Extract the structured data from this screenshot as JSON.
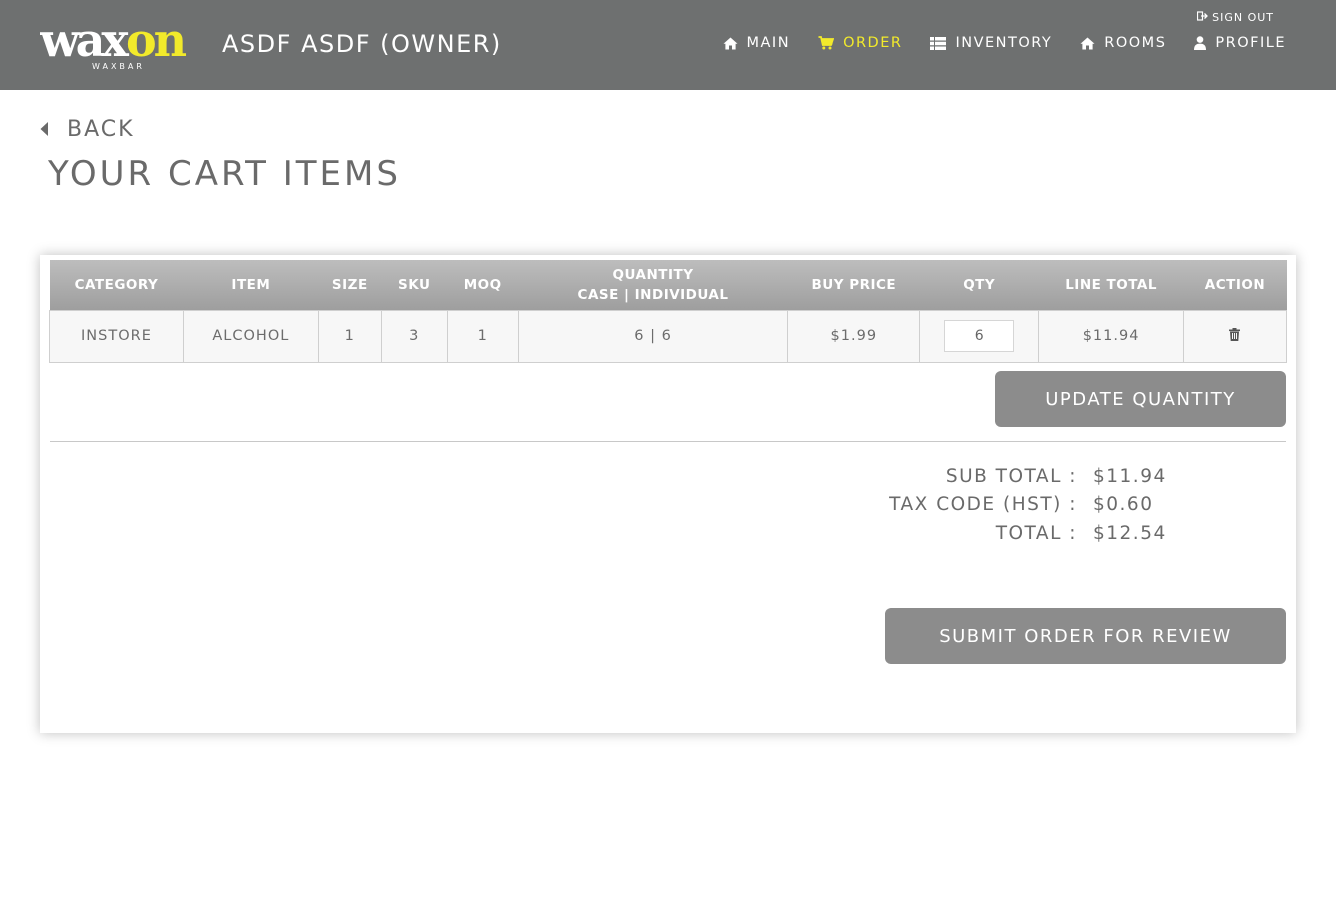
{
  "header": {
    "logo_text": "waxon",
    "logo_sub": "WAXBAR",
    "owner_label": "ASDF ASDF (OWNER)",
    "signout_label": "SIGN OUT",
    "nav": [
      {
        "label": "MAIN",
        "icon": "home-icon",
        "active": false
      },
      {
        "label": "ORDER",
        "icon": "cart-icon",
        "active": true
      },
      {
        "label": "INVENTORY",
        "icon": "list-icon",
        "active": false
      },
      {
        "label": "ROOMS",
        "icon": "home-icon",
        "active": false
      },
      {
        "label": "PROFILE",
        "icon": "user-icon",
        "active": false
      }
    ]
  },
  "colors": {
    "header_bg": "#6e7070",
    "accent": "#f2ea2b",
    "button_bg": "#8c8c8c"
  },
  "back_label": "BACK",
  "page_title": "YOUR CART ITEMS",
  "cart": {
    "columns": [
      "CATEGORY",
      "ITEM",
      "SIZE",
      "SKU",
      "MOQ",
      "QUANTITY",
      "BUY PRICE",
      "QTY",
      "LINE TOTAL",
      "ACTION"
    ],
    "quantity_subheader": "CASE | INDIVIDUAL",
    "rows": [
      {
        "category": "INSTORE",
        "item": "ALCOHOL",
        "size": "1",
        "sku": "3",
        "moq": "1",
        "quantity": "6 | 6",
        "buy_price": "$1.99",
        "qty": "6",
        "line_total": "$11.94"
      }
    ],
    "update_label": "UPDATE QUANTITY"
  },
  "totals": {
    "sub_total_label": "SUB TOTAL :",
    "sub_total": "$11.94",
    "tax_label": "TAX CODE (HST) :",
    "tax": "$0.60",
    "total_label": "TOTAL :",
    "total": "$12.54"
  },
  "submit_label": "SUBMIT ORDER FOR REVIEW"
}
